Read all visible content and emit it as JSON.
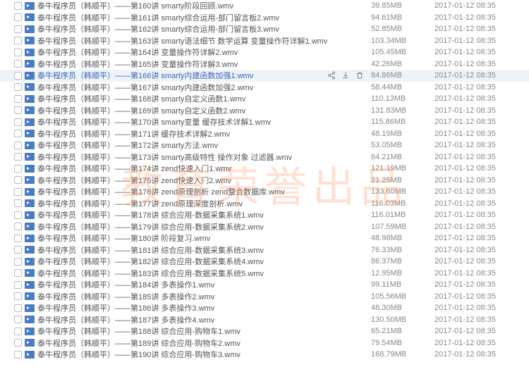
{
  "watermark": "教育荣誉出品",
  "files": [
    {
      "name": "泰牛程序员（韩顺平）——第160讲 smarty阶段回顾.wmv",
      "size": "39.85MB",
      "date": "2017-01-12 08:35",
      "selected": false
    },
    {
      "name": "泰牛程序员（韩顺平）——第161讲 smarty综合运用-部门留言板2.wmv",
      "size": "94.61MB",
      "date": "2017-01-12 08:35",
      "selected": false
    },
    {
      "name": "泰牛程序员（韩顺平）——第162讲 smarty综合运用-部门留言板3.wmv",
      "size": "52.85MB",
      "date": "2017-01-12 08:35",
      "selected": false
    },
    {
      "name": "泰牛程序员（韩顺平）——第163讲 smarty语法细节 数学运算 变量操作符详解1.wmv",
      "size": "103.34MB",
      "date": "2017-01-12 08:35",
      "selected": false
    },
    {
      "name": "泰牛程序员（韩顺平）——第164讲 变量操作符详解2.wmv",
      "size": "105.45MB",
      "date": "2017-01-12 08:35",
      "selected": false
    },
    {
      "name": "泰牛程序员（韩顺平）——第165讲 变量操作符详解3.wmv",
      "size": "42.26MB",
      "date": "2017-01-12 08:35",
      "selected": false
    },
    {
      "name": "泰牛程序员（韩顺平）——第166讲 smarty内建函数加强1.wmv",
      "size": "84.86MB",
      "date": "2017-01-12 08:35",
      "selected": true
    },
    {
      "name": "泰牛程序员（韩顺平）——第167讲 smarty内建函数加强2.wmv",
      "size": "58.44MB",
      "date": "2017-01-12 08:35",
      "selected": false
    },
    {
      "name": "泰牛程序员（韩顺平）——第168讲 smarty自定义函数1.wmv",
      "size": "110.13MB",
      "date": "2017-01-12 08:35",
      "selected": false
    },
    {
      "name": "泰牛程序员（韩顺平）——第169讲 smarty自定义函数2.wmv",
      "size": "131.83MB",
      "date": "2017-01-12 08:35",
      "selected": false
    },
    {
      "name": "泰牛程序员（韩顺平）——第170讲 smarty变量 缓存技术详解1.wmv",
      "size": "115.86MB",
      "date": "2017-01-12 08:35",
      "selected": false
    },
    {
      "name": "泰牛程序员（韩顺平）——第171讲 缓存技术详解2.wmv",
      "size": "48.19MB",
      "date": "2017-01-12 08:35",
      "selected": false
    },
    {
      "name": "泰牛程序员（韩顺平）——第172讲 smarty方法.wmv",
      "size": "53.05MB",
      "date": "2017-01-12 08:35",
      "selected": false
    },
    {
      "name": "泰牛程序员（韩顺平）——第173讲 smarty高级特性 操作对象 过滤器.wmv",
      "size": "64.21MB",
      "date": "2017-01-12 08:35",
      "selected": false
    },
    {
      "name": "泰牛程序员（韩顺平）——第174讲 zend快速入门1.wmv",
      "size": "121.19MB",
      "date": "2017-01-12 08:35",
      "selected": false
    },
    {
      "name": "泰牛程序员（韩顺平）——第175讲 zend快速入门2.wmv",
      "size": "21.25MB",
      "date": "2017-01-12 08:35",
      "selected": false
    },
    {
      "name": "泰牛程序员（韩顺平）——第176讲 zend原理剖析 zend整合数据库.wmv",
      "size": "133.60MB",
      "date": "2017-01-12 08:35",
      "selected": false
    },
    {
      "name": "泰牛程序员（韩顺平）——第177讲 zend原理深度剖析.wmv",
      "size": "116.03MB",
      "date": "2017-01-12 08:35",
      "selected": false
    },
    {
      "name": "泰牛程序员（韩顺平）——第178讲 综合应用-数据采集系统1.wmv",
      "size": "116.01MB",
      "date": "2017-01-12 08:35",
      "selected": false
    },
    {
      "name": "泰牛程序员（韩顺平）——第179讲 综合应用-数据采集系统2.wmv",
      "size": "107.59MB",
      "date": "2017-01-12 08:35",
      "selected": false
    },
    {
      "name": "泰牛程序员（韩顺平）——第180讲 阶段复习.wmv",
      "size": "48.98MB",
      "date": "2017-01-12 08:35",
      "selected": false
    },
    {
      "name": "泰牛程序员（韩顺平）——第181讲 综合应用-数据采集系统3.wmv",
      "size": "76.33MB",
      "date": "2017-01-12 08:35",
      "selected": false
    },
    {
      "name": "泰牛程序员（韩顺平）——第182讲 综合应用-数据采集系统4.wmv",
      "size": "86.37MB",
      "date": "2017-01-12 08:35",
      "selected": false
    },
    {
      "name": "泰牛程序员（韩顺平）——第183讲 综合应用-数据采集系统5.wmv",
      "size": "12.95MB",
      "date": "2017-01-12 08:35",
      "selected": false
    },
    {
      "name": "泰牛程序员（韩顺平）——第184讲 多表操作1.wmv",
      "size": "99.11MB",
      "date": "2017-01-12 08:35",
      "selected": false
    },
    {
      "name": "泰牛程序员（韩顺平）——第185讲 多表操作2.wmv",
      "size": "105.56MB",
      "date": "2017-01-12 08:35",
      "selected": false
    },
    {
      "name": "泰牛程序员（韩顺平）——第186讲 多表操作3.wmv",
      "size": "48.30MB",
      "date": "2017-01-12 08:35",
      "selected": false
    },
    {
      "name": "泰牛程序员（韩顺平）——第187讲 多表操作4.wmv",
      "size": "130.50MB",
      "date": "2017-01-12 08:35",
      "selected": false
    },
    {
      "name": "泰牛程序员（韩顺平）——第188讲 综合应用-购物车1.wmv",
      "size": "65.21MB",
      "date": "2017-01-12 08:35",
      "selected": false
    },
    {
      "name": "泰牛程序员（韩顺平）——第189讲 综合应用-购物车2.wmv",
      "size": "79.54MB",
      "date": "2017-01-12 08:35",
      "selected": false
    },
    {
      "name": "泰牛程序员（韩顺平）——第190讲 综合应用-购物车3.wmv",
      "size": "168.79MB",
      "date": "2017-01-12 08:35",
      "selected": false
    }
  ]
}
